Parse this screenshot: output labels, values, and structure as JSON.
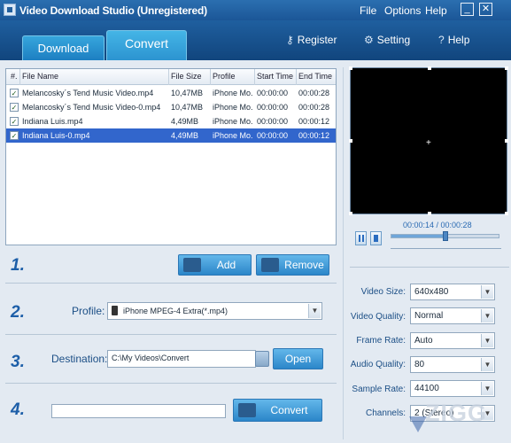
{
  "app": {
    "title": "Video Download Studio (Unregistered)",
    "menu": [
      "File",
      "Options",
      "Help"
    ],
    "minimize_symbol": "_",
    "close_symbol": "✕"
  },
  "tabs": [
    {
      "label": "Download",
      "active": false
    },
    {
      "label": "Convert",
      "active": true
    }
  ],
  "toplinks": [
    {
      "label": "Register",
      "icon": "key-icon"
    },
    {
      "label": "Setting",
      "icon": "gear-icon"
    },
    {
      "label": "Help",
      "icon": "help-icon"
    }
  ],
  "table": {
    "headers": [
      "#.",
      "File Name",
      "File Size",
      "Profile",
      "Start Time",
      "End Time"
    ],
    "rows": [
      {
        "checked": true,
        "name": "Melancosky´s Tend Music Video.mp4",
        "size": "10,47MB",
        "profile": "iPhone Mo...",
        "start": "00:00:00",
        "end": "00:00:28",
        "selected": false
      },
      {
        "checked": true,
        "name": "Melancosky´s Tend Music Video-0.mp4",
        "size": "10,47MB",
        "profile": "iPhone Mo...",
        "start": "00:00:00",
        "end": "00:00:28",
        "selected": false
      },
      {
        "checked": true,
        "name": "Indiana Luis.mp4",
        "size": "4,49MB",
        "profile": "iPhone Mo...",
        "start": "00:00:00",
        "end": "00:00:12",
        "selected": false
      },
      {
        "checked": true,
        "name": "Indiana Luis-0.mp4",
        "size": "4,49MB",
        "profile": "iPhone Mo...",
        "start": "00:00:00",
        "end": "00:00:12",
        "selected": true
      }
    ],
    "check_mark": "✓"
  },
  "player": {
    "timecode": "00:00:14 / 00:00:28",
    "progress_percent": 50,
    "crosshair": "+"
  },
  "steps": {
    "step1": "1.",
    "step2": "2.",
    "step3": "3.",
    "step4": "4."
  },
  "buttons": {
    "add": "Add",
    "remove": "Remove",
    "open": "Open",
    "convert": "Convert"
  },
  "profile": {
    "label": "Profile:",
    "value": "iPhone MPEG-4 Extra(*.mp4)",
    "arrow": "▼"
  },
  "destination": {
    "label": "Destination:",
    "value": "C:\\My Videos\\Convert"
  },
  "convert_progress": {
    "value": ""
  },
  "settings": [
    {
      "label": "Video Size:",
      "value": "640x480"
    },
    {
      "label": "Video Quality:",
      "value": "Normal"
    },
    {
      "label": "Frame Rate:",
      "value": "Auto"
    },
    {
      "label": "Audio Quality:",
      "value": "80"
    },
    {
      "label": "Sample Rate:",
      "value": "44100"
    },
    {
      "label": "Channels:",
      "value": "2 (Stereo)"
    }
  ],
  "watermark": "ZIGG"
}
